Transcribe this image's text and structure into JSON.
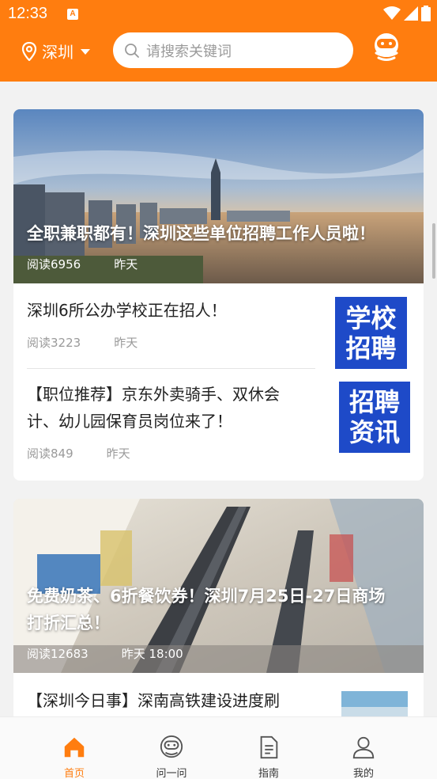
{
  "status_bar": {
    "time": "12:33",
    "notif_letter": "A"
  },
  "header": {
    "city": "深圳",
    "search_placeholder": "请搜索关键词"
  },
  "feed": {
    "card1": {
      "hero_title": "全职兼职都有！深圳这些单位招聘工作人员啦！",
      "hero_reads": "阅读6956",
      "hero_time": "昨天",
      "items": [
        {
          "title": "深圳6所公办学校正在招人！",
          "reads": "阅读3223",
          "time": "昨天",
          "thumb_line1": "学校",
          "thumb_line2": "招聘"
        },
        {
          "title_line1": "【职位推荐】京东外卖骑手、双休会",
          "title_line2": "计、幼儿园保育员岗位来了！",
          "reads": "阅读849",
          "time": "昨天",
          "thumb_line1": "招聘",
          "thumb_line2": "资讯"
        }
      ]
    },
    "card2": {
      "hero_title_line1": "免费奶茶、6折餐饮券！深圳7月25日-27日商场",
      "hero_title_line2": "打折汇总！",
      "hero_reads": "阅读12683",
      "hero_time": "昨天 18:00",
      "item_title": "【深圳今日事】深南高铁建设进度刷"
    }
  },
  "bottom_nav": {
    "tabs": [
      {
        "label": "首页",
        "icon": "home-icon",
        "active": true
      },
      {
        "label": "问一问",
        "icon": "robot-chat-icon",
        "active": false
      },
      {
        "label": "指南",
        "icon": "document-icon",
        "active": false
      },
      {
        "label": "我的",
        "icon": "person-icon",
        "active": false
      }
    ]
  },
  "colors": {
    "brand": "#ff7d0f",
    "thumb_blue": "#1e4ac8",
    "muted": "#9a9a9a"
  }
}
